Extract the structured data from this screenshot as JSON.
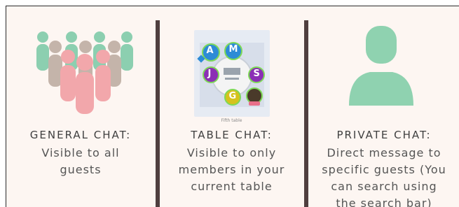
{
  "columns": [
    {
      "title": "GENERAL CHAT:",
      "description": "Visible to all\nguests"
    },
    {
      "title": "TABLE CHAT:",
      "description": "Visible to only\nmembers in your\ncurrent table",
      "table_caption": "Fifth table",
      "seat_letters": [
        "A",
        "M",
        "J",
        "S",
        "G"
      ]
    },
    {
      "title": "PRIVATE CHAT:",
      "description": "Direct message to\nspecific guests (You\ncan search using\nthe search bar)"
    }
  ],
  "colors": {
    "background": "#fdf6f2",
    "divider": "#4f3f3f",
    "green_person": "#8ccfb0",
    "pink_person": "#f2a7ab",
    "taupe_person": "#c4b4aa",
    "avatar_green": "#8fd2b0"
  }
}
